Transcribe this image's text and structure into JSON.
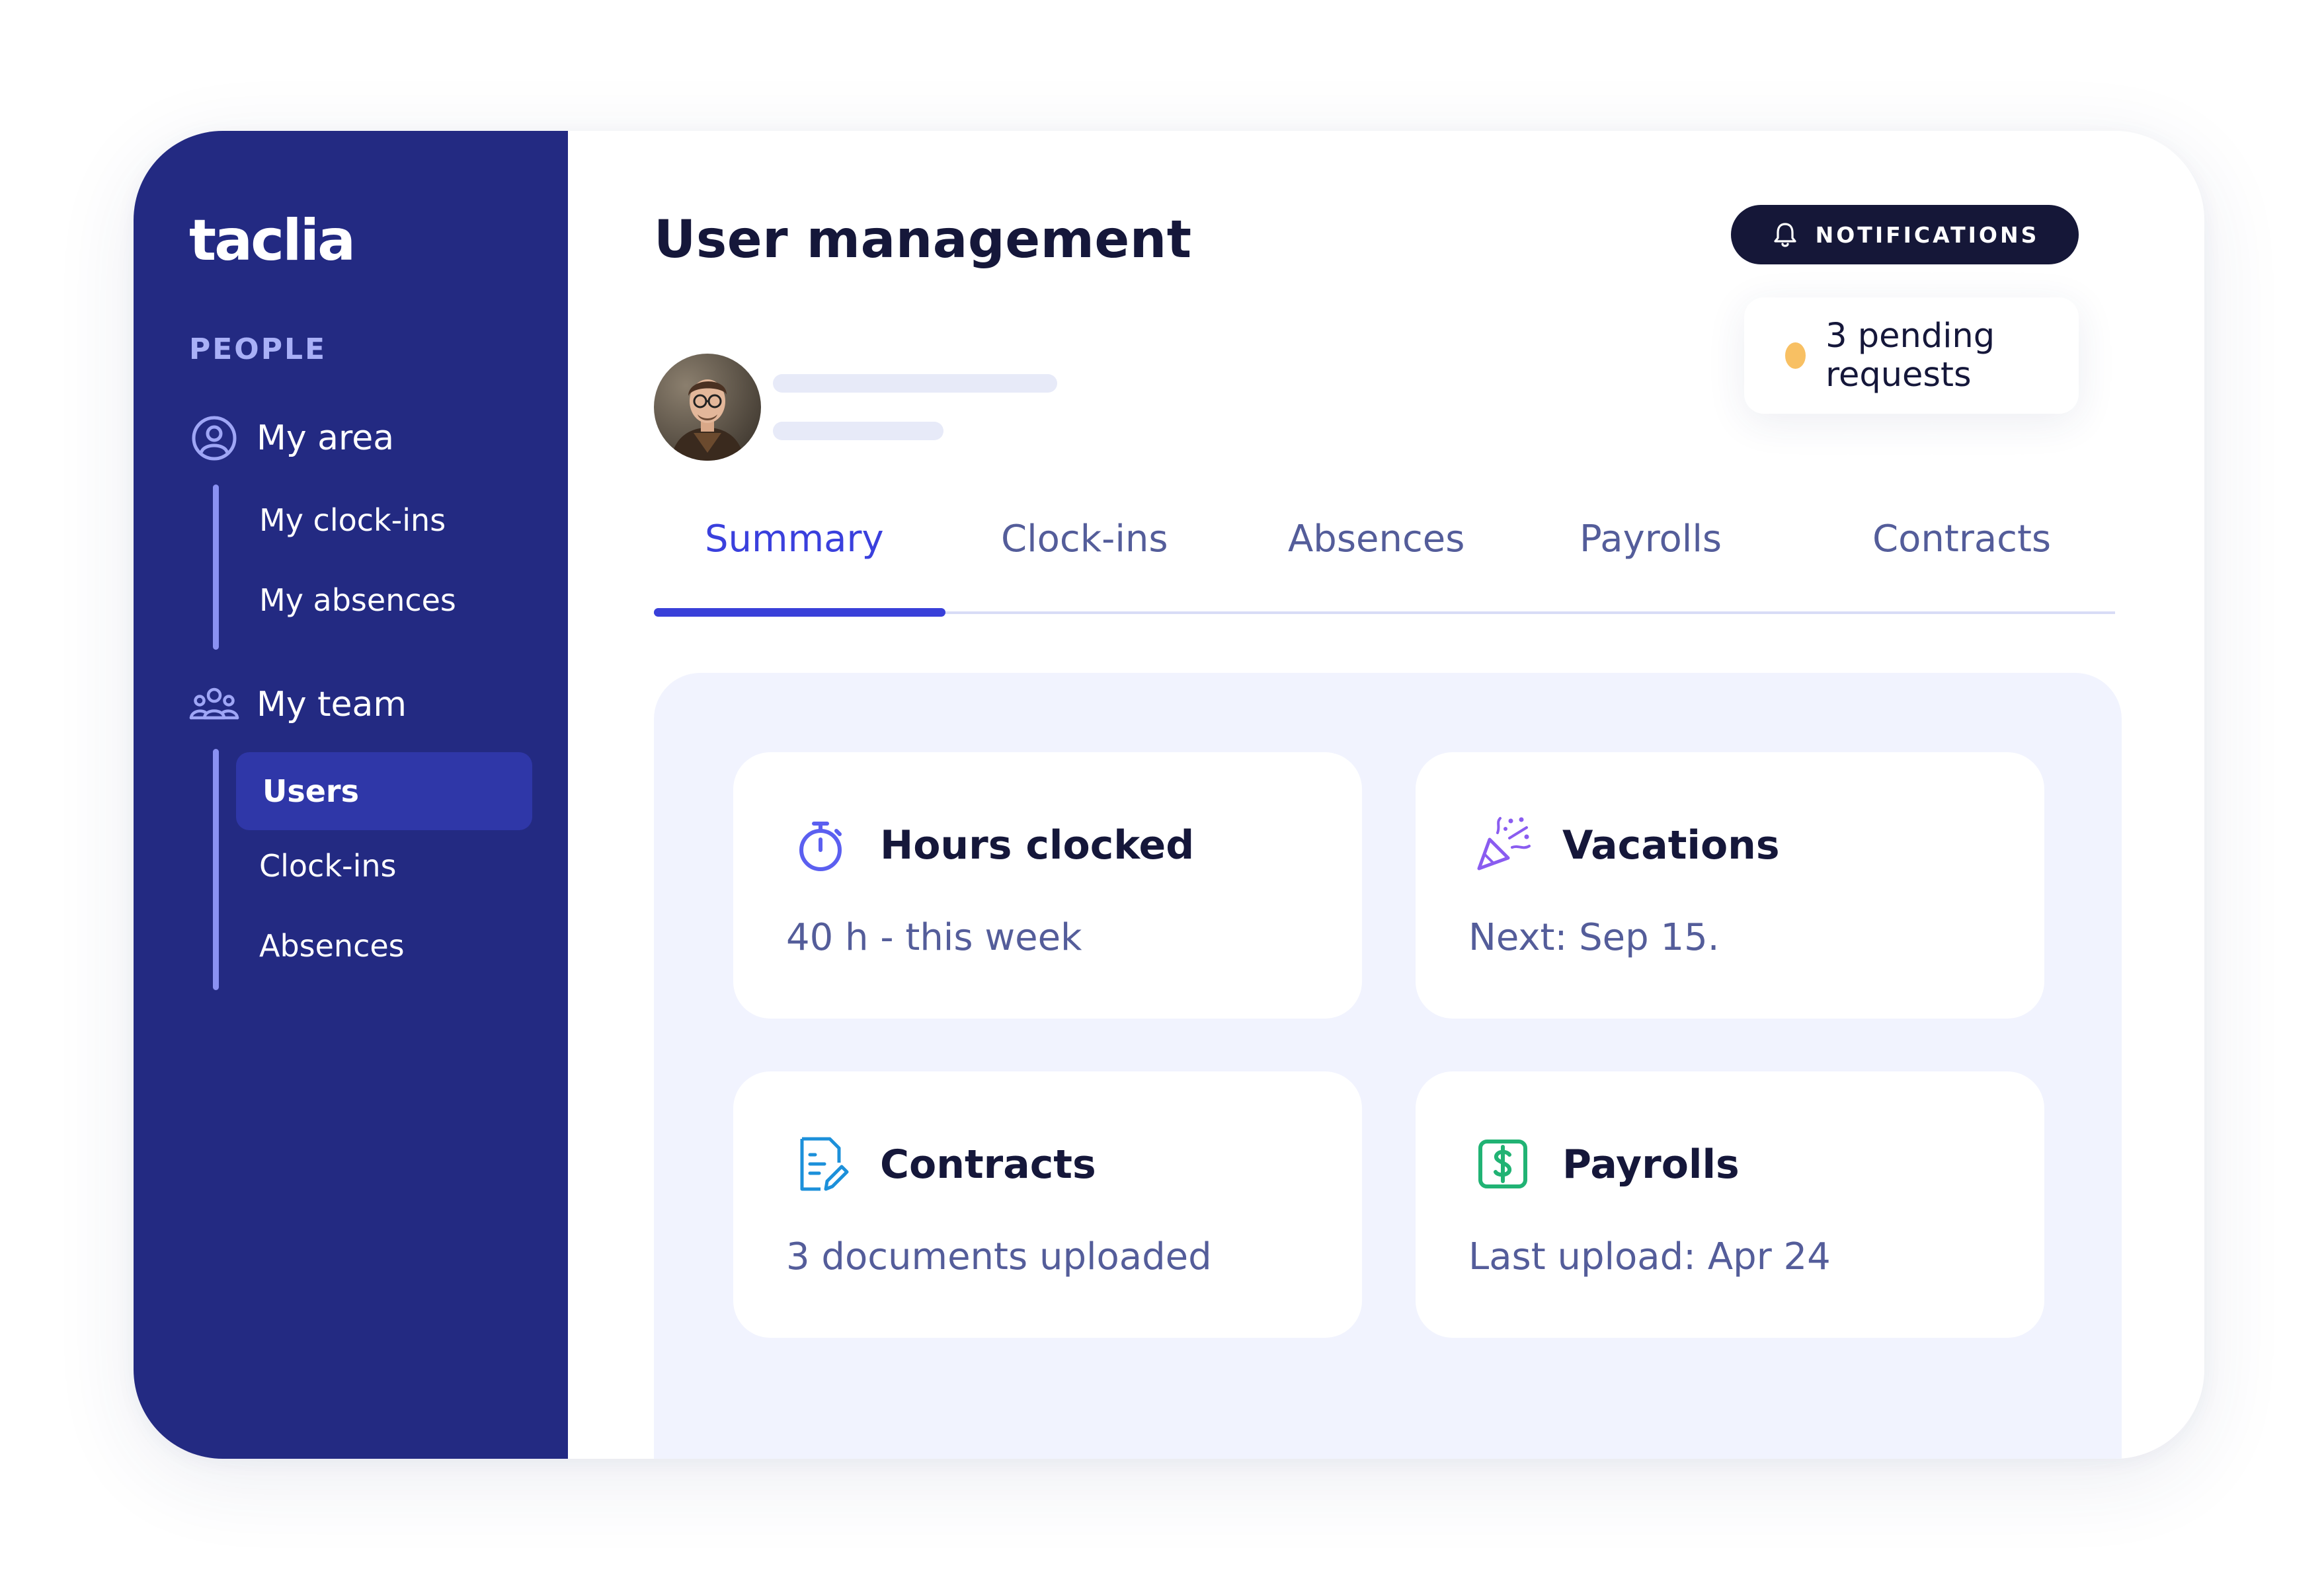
{
  "app": {
    "logo": "taclia"
  },
  "sidebar": {
    "section_label": "PEOPLE",
    "groups": [
      {
        "label": "My area",
        "icon": "user-circle-icon",
        "items": [
          {
            "label": "My clock-ins"
          },
          {
            "label": "My absences"
          }
        ]
      },
      {
        "label": "My team",
        "icon": "team-icon",
        "items": [
          {
            "label": "Users",
            "active": true
          },
          {
            "label": "Clock-ins"
          },
          {
            "label": "Absences"
          }
        ]
      }
    ]
  },
  "header": {
    "title": "User management",
    "notifications_label": "NOTIFICATIONS",
    "pending_text": "3 pending requests"
  },
  "tabs": [
    {
      "label": "Summary",
      "active": true
    },
    {
      "label": "Clock-ins"
    },
    {
      "label": "Absences"
    },
    {
      "label": "Payrolls"
    },
    {
      "label": "Contracts"
    }
  ],
  "cards": [
    {
      "title": "Hours clocked",
      "subtitle": "40 h - this week",
      "icon": "stopwatch-icon"
    },
    {
      "title": "Vacations",
      "subtitle": "Next: Sep 15.",
      "icon": "party-popper-icon"
    },
    {
      "title": "Contracts",
      "subtitle": "3 documents uploaded",
      "icon": "document-edit-icon"
    },
    {
      "title": "Payrolls",
      "subtitle": "Last upload: Apr 24",
      "icon": "dollar-bill-icon"
    }
  ],
  "colors": {
    "sidebar_bg": "#232a82",
    "accent": "#3a40dd",
    "pending_dot": "#f8c063",
    "content_bg": "#f1f3fe",
    "dark_button": "#151738"
  }
}
